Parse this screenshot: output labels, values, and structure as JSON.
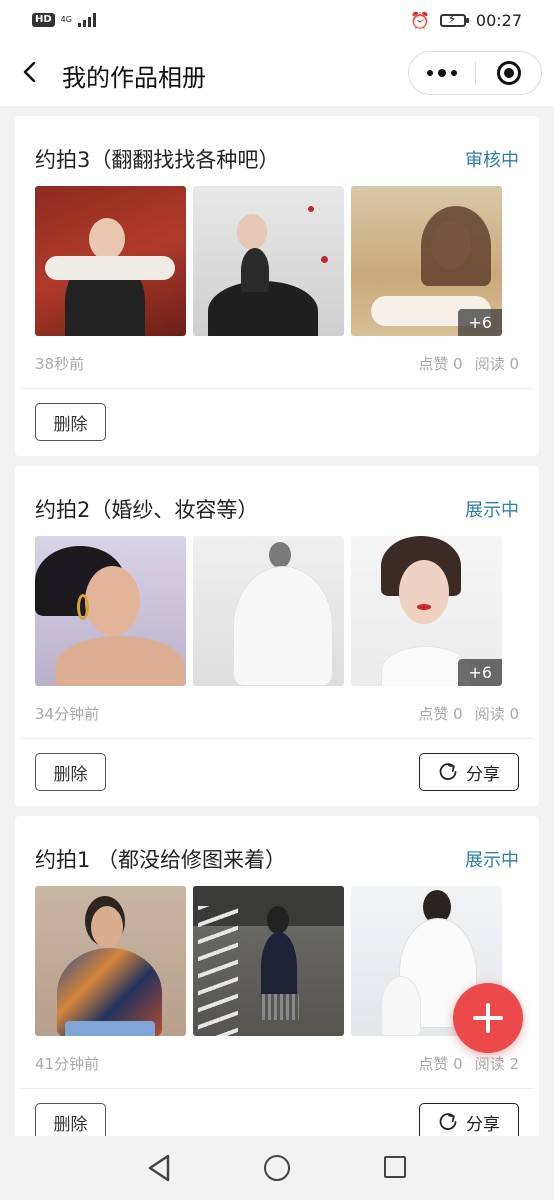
{
  "status_bar": {
    "network_badge": "HD",
    "network_type": "4G",
    "time": "00:27"
  },
  "nav": {
    "title": "我的作品相册",
    "more_icon": "more-dots-icon",
    "close_icon": "target-circle-icon"
  },
  "albums": [
    {
      "title": "约拍3（翻翻找找各种吧）",
      "status": "审核中",
      "photo_more": "+6",
      "time": "38秒前",
      "likes": "点赞 0",
      "reads": "阅读 0",
      "delete_label": "删除",
      "share_label": ""
    },
    {
      "title": "约拍2（婚纱、妆容等）",
      "status": "展示中",
      "photo_more": "+6",
      "time": "34分钟前",
      "likes": "点赞 0",
      "reads": "阅读 0",
      "delete_label": "删除",
      "share_label": "分享"
    },
    {
      "title": "约拍1 （都没给修图来着）",
      "status": "展示中",
      "photo_more": "",
      "time": "41分钟前",
      "likes": "点赞 0",
      "reads": "阅读 2",
      "delete_label": "删除",
      "share_label": "分享"
    }
  ],
  "fab": {
    "icon": "plus-icon"
  },
  "colors": {
    "status_blue": "#2f7fa8",
    "fab_red": "#ec4a4a"
  }
}
